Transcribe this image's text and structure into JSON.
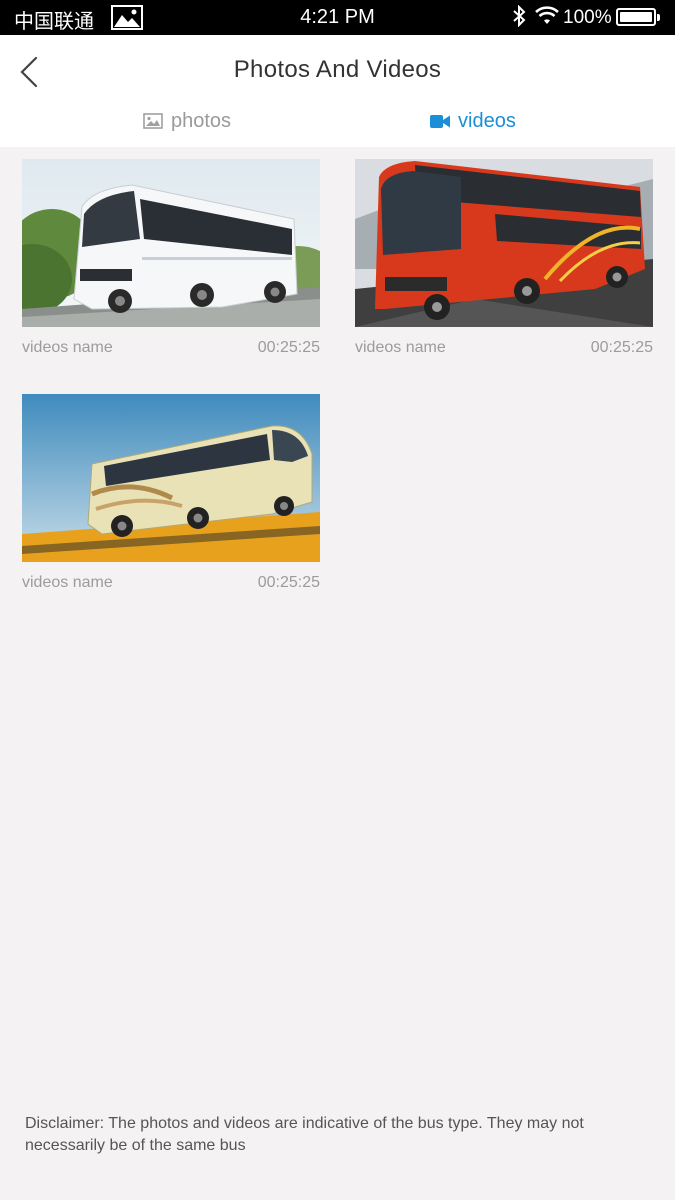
{
  "status_bar": {
    "carrier": "中国联通",
    "time": "4:21 PM",
    "battery": "100%"
  },
  "header": {
    "title": "Photos And Videos",
    "back_icon": "chevron-left-icon"
  },
  "tabs": [
    {
      "label": "photos",
      "icon": "image-icon",
      "active": false
    },
    {
      "label": "videos",
      "icon": "video-camera-icon",
      "active": true
    }
  ],
  "colors": {
    "accent": "#1a8fd8",
    "inactive_tab": "#9a9a9a",
    "background": "#f4f2f3"
  },
  "videos": [
    {
      "name": "videos name",
      "duration": "00:25:25"
    },
    {
      "name": "videos name",
      "duration": "00:25:25"
    },
    {
      "name": "videos name",
      "duration": "00:25:25"
    }
  ],
  "disclaimer": "Disclaimer: The photos and videos are indicative of the bus type. They may not necessarily be of the same bus"
}
